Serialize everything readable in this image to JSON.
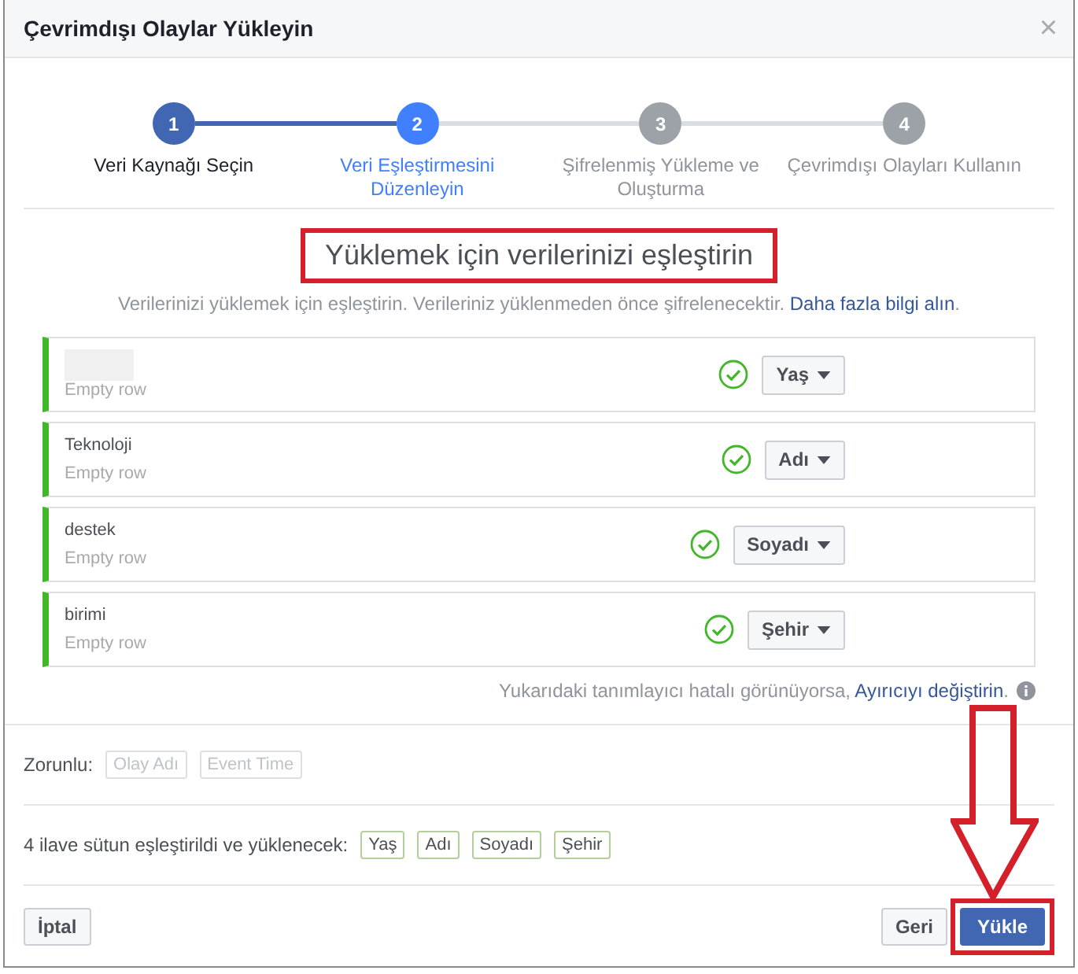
{
  "dialog": {
    "title": "Çevrimdışı Olaylar Yükleyin",
    "close": "×"
  },
  "steps": [
    {
      "number": "1",
      "label": "Veri Kaynağı Seçin",
      "completed": true,
      "selected": false
    },
    {
      "number": "2",
      "label": "Veri Eşleştirmesini Düzenleyin",
      "completed": false,
      "selected": true
    },
    {
      "number": "3",
      "label": "Şifrelenmiş Yükleme ve Oluşturma",
      "completed": false,
      "selected": false
    },
    {
      "number": "4",
      "label": "Çevrimdışı Olayları Kullanın",
      "completed": false,
      "selected": false
    }
  ],
  "heading": "Yüklemek için verilerinizi eşleştirin",
  "subtitle": "Verilerinizi yüklemek için eşleştirin. Verileriniz yüklenmeden önce şifrelenecektir.",
  "subtitle_link": "Daha fazla bilgi alın",
  "subtitle_end": ".",
  "rows": [
    {
      "redacted": true,
      "sample": "Empty row",
      "matched": true,
      "mapping": "Yaş"
    },
    {
      "name": "Teknoloji",
      "sample": "Empty row",
      "matched": true,
      "mapping": "Adı"
    },
    {
      "name": "destek",
      "sample": "Empty row",
      "matched": true,
      "mapping": "Soyadı"
    },
    {
      "name": "birimi",
      "sample": "Empty row",
      "matched": true,
      "mapping": "Şehir"
    }
  ],
  "separator_hint": "Yukarıdaki tanımlayıcı hatalı görünüyorsa,",
  "separator_link": "Ayırıcıyı değiştirin",
  "separator_end": ".",
  "required": {
    "label": "Zorunlu:",
    "tags": [
      {
        "label": "Olay Adı",
        "disabled": true
      },
      {
        "label": "Event Time",
        "disabled": true
      }
    ]
  },
  "mapped": {
    "label": "4 ilave sütun eşleştirildi ve yüklenecek:",
    "tags": [
      "Yaş",
      "Adı",
      "Soyadı",
      "Şehir"
    ]
  },
  "buttons": {
    "cancel": "İptal",
    "back": "Geri",
    "upload": "Yükle"
  }
}
